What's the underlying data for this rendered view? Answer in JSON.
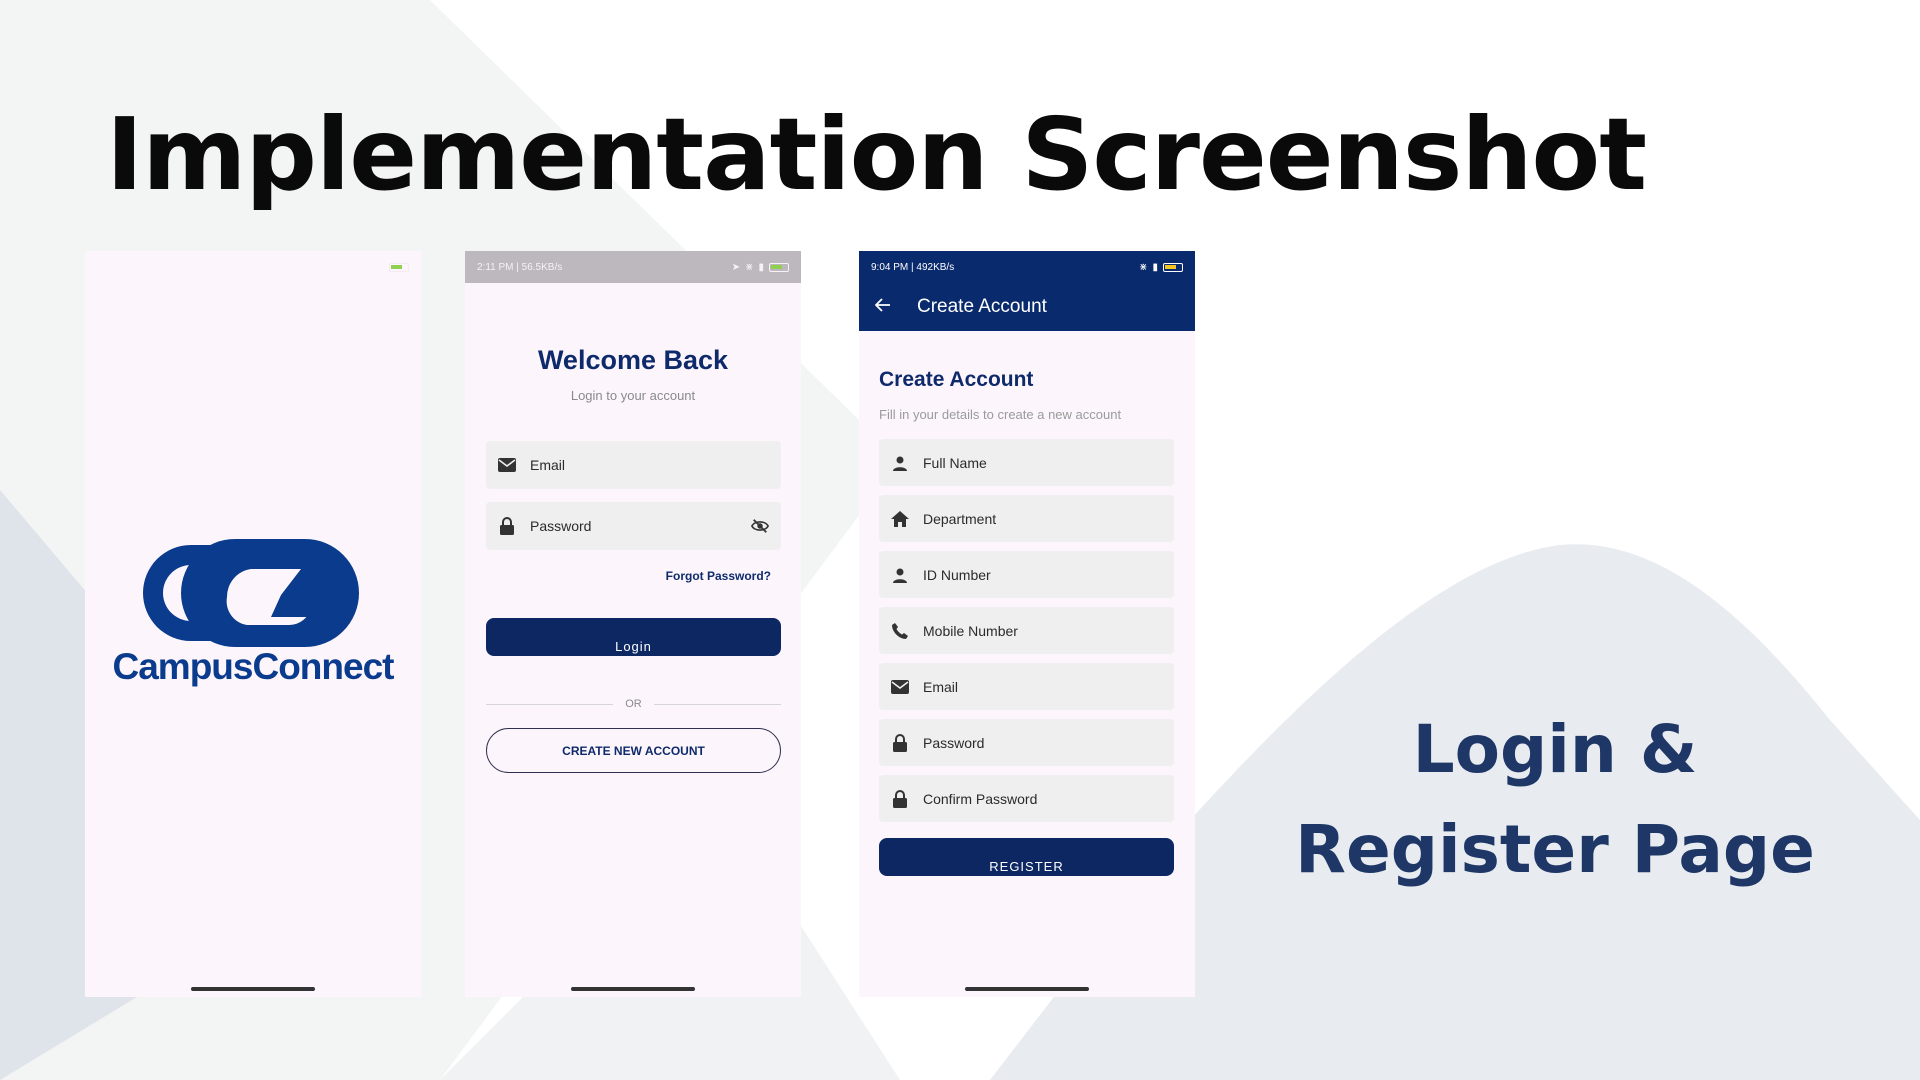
{
  "slide": {
    "title": "Implementation Screenshot",
    "caption": "Login & Register Page"
  },
  "colors": {
    "navy": "#0d2763",
    "brand_blue": "#0a3b8c",
    "phone_bg": "#fcf6fc",
    "field_bg": "#efefef"
  },
  "splash": {
    "brand_name": "CampusConnect",
    "logo_icon": "campusconnect-logo"
  },
  "login": {
    "status_time": "2:11 PM | 56.5KB/s",
    "title": "Welcome Back",
    "subtitle": "Login to your account",
    "email_placeholder": "Email",
    "password_placeholder": "Password",
    "forgot_label": "Forgot Password?",
    "login_label": "Login",
    "or_label": "OR",
    "create_label": "CREATE NEW ACCOUNT"
  },
  "register": {
    "status_time": "9:04 PM | 492KB/s",
    "appbar_title": "Create Account",
    "title": "Create Account",
    "subtitle": "Fill in your details to create a new account",
    "fields": [
      {
        "label": "Full Name",
        "icon": "person-icon"
      },
      {
        "label": "Department",
        "icon": "home-icon"
      },
      {
        "label": "ID Number",
        "icon": "person-icon"
      },
      {
        "label": "Mobile Number",
        "icon": "phone-icon"
      },
      {
        "label": "Email",
        "icon": "mail-icon"
      },
      {
        "label": "Password",
        "icon": "lock-icon"
      },
      {
        "label": "Confirm Password",
        "icon": "lock-icon"
      }
    ],
    "register_label": "REGISTER"
  }
}
